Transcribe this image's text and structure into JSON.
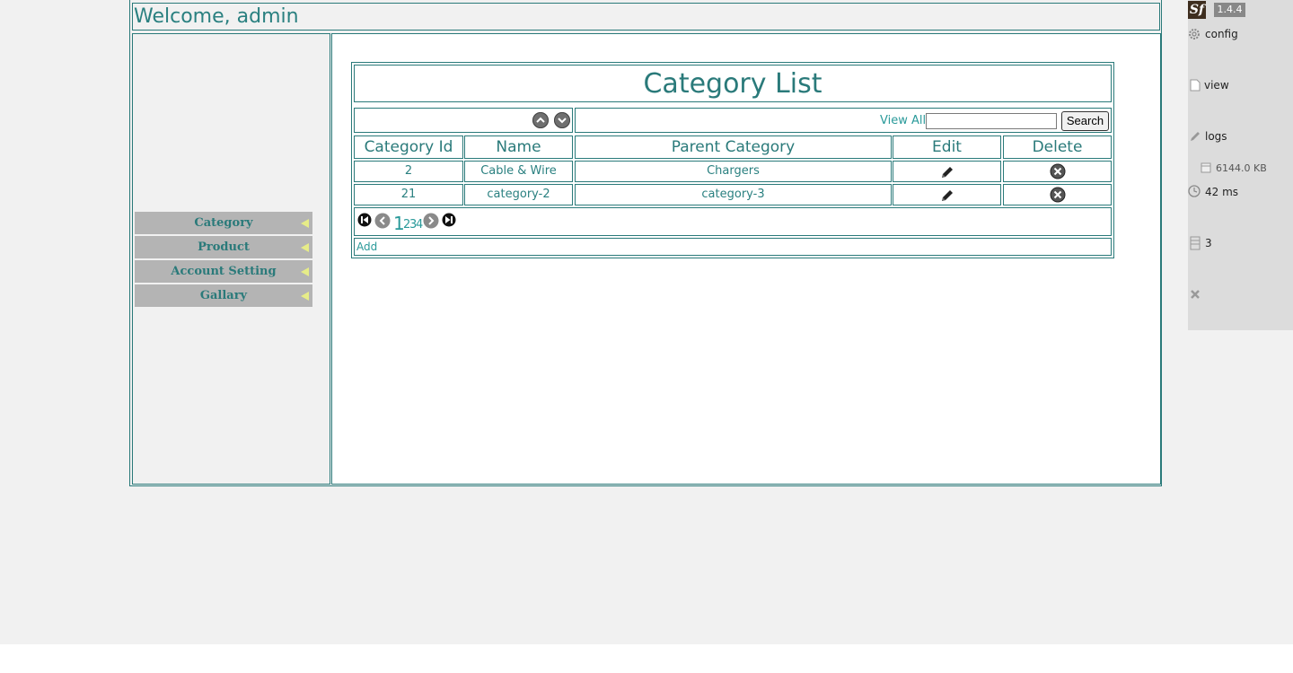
{
  "header": {
    "welcome": "Welcome, admin"
  },
  "sidebar": {
    "items": [
      {
        "label": "Category"
      },
      {
        "label": "Product"
      },
      {
        "label": "Account Setting"
      },
      {
        "label": "Gallary"
      }
    ]
  },
  "list": {
    "title": "Category List",
    "view_all": "View All",
    "search_value": "",
    "search_button": "Search",
    "columns": [
      "Category Id",
      "Name",
      "Parent Category",
      "Edit",
      "Delete"
    ],
    "rows": [
      {
        "id": "2",
        "name": "Cable & Wire",
        "parent": "Chargers"
      },
      {
        "id": "21",
        "name": "category-2",
        "parent": "category-3"
      }
    ],
    "pages": [
      "1",
      "2",
      "3",
      "4"
    ],
    "current_page": "1",
    "add_label": "Add"
  },
  "debug_toolbar": {
    "logo": "Sf",
    "version": "1.4.4",
    "config": "config",
    "view": "view",
    "logs": "logs",
    "memory": "6144.0 KB",
    "time": "42 ms",
    "db_queries": "3"
  },
  "colors": {
    "accent": "#2a7a7a",
    "menu_bg": "#b4b4b4",
    "menu_arrow": "#e6ec88"
  }
}
